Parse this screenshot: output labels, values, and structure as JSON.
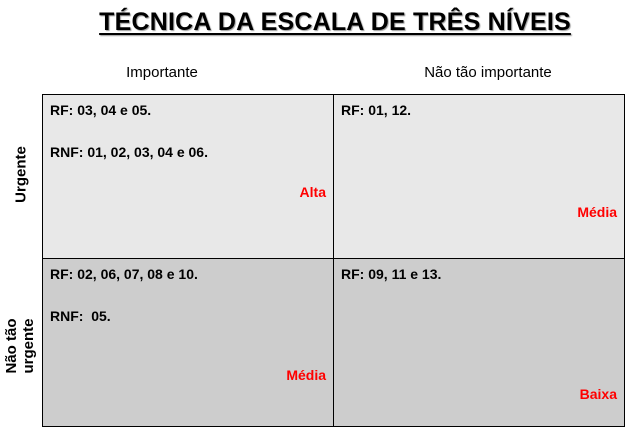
{
  "title": "TÉCNICA DA ESCALA DE TRÊS NÍVEIS",
  "columns": [
    "Importante",
    "Não tão importante"
  ],
  "rows": [
    "Urgente",
    "Não tão\nurgente"
  ],
  "cells": {
    "top_left": {
      "line1": "RF: 03, 04 e 05.",
      "line2": "RNF: 01, 02, 03, 04 e 06.",
      "priority": "Alta"
    },
    "top_right": {
      "line1": "RF: 01, 12.",
      "priority": "Média"
    },
    "bottom_left": {
      "line1": "RF: 02, 06, 07, 08 e 10.",
      "line2": "RNF:  05.",
      "priority": "Média"
    },
    "bottom_right": {
      "line1": "RF: 09, 11 e 13.",
      "priority": "Baixa"
    }
  },
  "colors": {
    "priority_text": "#ff0000",
    "top_row_fill": "#e8e8e8",
    "bottom_row_fill": "#cdcdcd"
  }
}
